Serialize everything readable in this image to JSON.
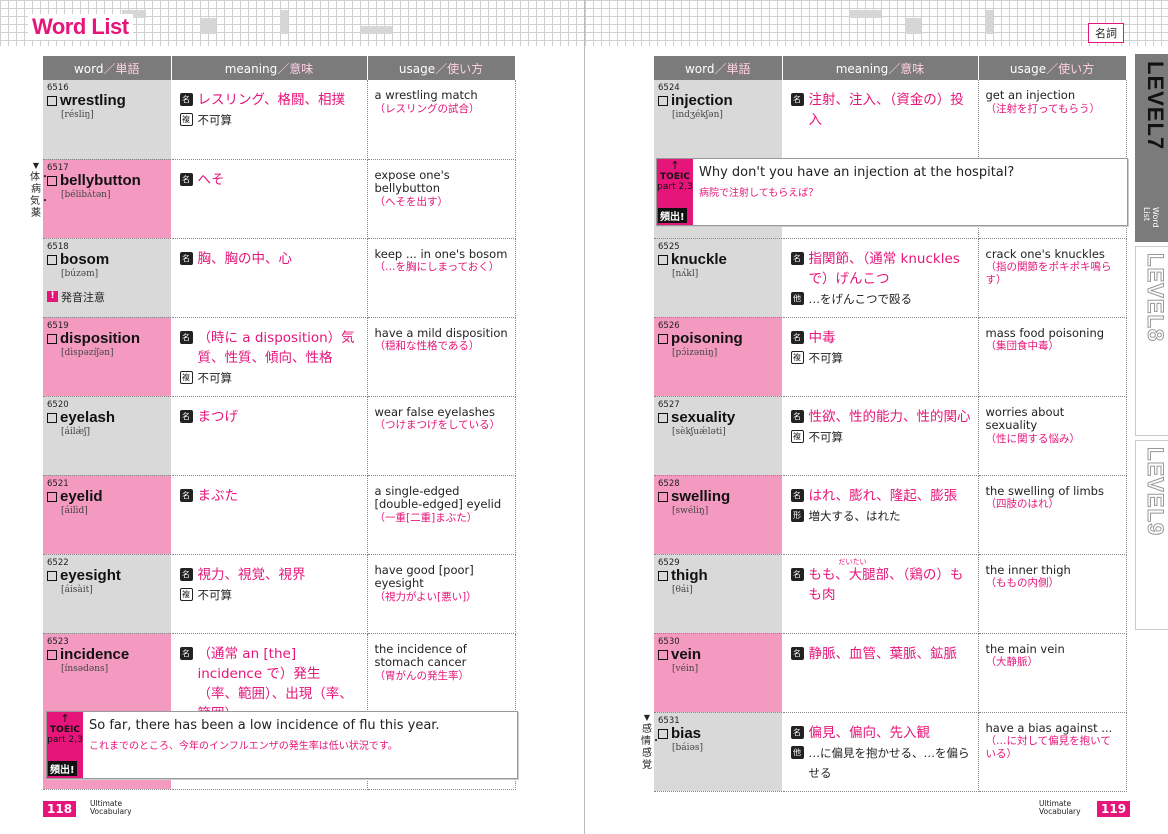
{
  "header": {
    "title": "Word List",
    "pos_tag": "名詞"
  },
  "columns": {
    "word_en": "word",
    "word_jp": "／単語",
    "meaning_en": "meaning",
    "meaning_jp": "／意味",
    "usage_en": "usage",
    "usage_jp": "／使い方"
  },
  "left_rows": [
    {
      "num": "6516",
      "word": "wrestling",
      "ipa": "[résliŋ]",
      "meanings": [
        {
          "badge": "名",
          "text": "レスリング、格闘、相撲",
          "pink": true
        },
        {
          "badge": "複",
          "text": "不可算",
          "pink": false
        }
      ],
      "usage": "a wrestling match",
      "usage_jp": "（レスリングの試合）"
    },
    {
      "num": "6517",
      "word": "bellybutton",
      "ipa": "[bélibʌ̀tən]",
      "meanings": [
        {
          "badge": "名",
          "text": "へそ",
          "pink": true
        }
      ],
      "usage": "expose one's bellybutton",
      "usage_jp": "（へそを出す）"
    },
    {
      "num": "6518",
      "word": "bosom",
      "ipa": "[búzəm]",
      "meanings": [
        {
          "badge": "名",
          "text": "胸、胸の中、心",
          "pink": true
        }
      ],
      "usage": "keep ... in one's bosom",
      "usage_jp": "（…を胸にしまっておく）",
      "pron_note": "発音注意"
    },
    {
      "num": "6519",
      "word": "disposition",
      "ipa": "[dìspəzíʃən]",
      "meanings": [
        {
          "badge": "名",
          "text": "（時に a disposition）気質、性質、傾向、性格",
          "pink": true
        },
        {
          "badge": "複",
          "text": "不可算",
          "pink": false
        }
      ],
      "usage": "have a mild disposition",
      "usage_jp": "（穏和な性格である）"
    },
    {
      "num": "6520",
      "word": "eyelash",
      "ipa": "[áilæ̀ʃ]",
      "meanings": [
        {
          "badge": "名",
          "text": "まつげ",
          "pink": true
        }
      ],
      "usage": "wear false eyelashes",
      "usage_jp": "（つけまつげをしている）"
    },
    {
      "num": "6521",
      "word": "eyelid",
      "ipa": "[áilìd]",
      "meanings": [
        {
          "badge": "名",
          "text": "まぶた",
          "pink": true
        }
      ],
      "usage": "a single-edged [double-edged] eyelid",
      "usage_jp": "（一重[二重]まぶた）"
    },
    {
      "num": "6522",
      "word": "eyesight",
      "ipa": "[áisàit]",
      "meanings": [
        {
          "badge": "名",
          "text": "視力、視覚、視界",
          "pink": true
        },
        {
          "badge": "複",
          "text": "不可算",
          "pink": false
        }
      ],
      "usage": "have good [poor] eyesight",
      "usage_jp": "（視力がよい[悪い]）"
    },
    {
      "num": "6523",
      "word": "incidence",
      "ipa": "[ínsədəns]",
      "meanings": [
        {
          "badge": "名",
          "text": "（通常 an [the] incidence で）発生（率、範囲）、出現（率、範囲）",
          "pink": true
        }
      ],
      "usage": "the incidence of stomach cancer",
      "usage_jp": "（胃がんの発生率）"
    }
  ],
  "right_rows": [
    {
      "num": "6524",
      "word": "injection",
      "ipa": "[indʒékʃən]",
      "meanings": [
        {
          "badge": "名",
          "text": "注射、注入、（資金の）投入",
          "pink": true
        }
      ],
      "usage": "get an injection",
      "usage_jp": "（注射を打ってもらう）"
    },
    {
      "num": "6525",
      "word": "knuckle",
      "ipa": "[nʌ́kl]",
      "meanings": [
        {
          "badge": "名",
          "text": "指関節、（通常 knuckles で）げんこつ",
          "pink": true
        },
        {
          "badge": "他",
          "text": "…をげんこつで殴る",
          "pink": false
        }
      ],
      "usage": "crack one's knuckles",
      "usage_jp": "（指の関節をポキポキ鳴らす）"
    },
    {
      "num": "6526",
      "word": "poisoning",
      "ipa": "[pɔ́izəniŋ]",
      "meanings": [
        {
          "badge": "名",
          "text": "中毒",
          "pink": true
        },
        {
          "badge": "複",
          "text": "不可算",
          "pink": false
        }
      ],
      "usage": "mass food poisoning",
      "usage_jp": "（集団食中毒）"
    },
    {
      "num": "6527",
      "word": "sexuality",
      "ipa": "[sèkʃuǽləti]",
      "meanings": [
        {
          "badge": "名",
          "text": "性欲、性的能力、性的関心",
          "pink": true
        },
        {
          "badge": "複",
          "text": "不可算",
          "pink": false
        }
      ],
      "usage": "worries about sexuality",
      "usage_jp": "（性に関する悩み）"
    },
    {
      "num": "6528",
      "word": "swelling",
      "ipa": "[swéliŋ]",
      "meanings": [
        {
          "badge": "名",
          "text": "はれ、膨れ、隆起、膨張",
          "pink": true
        },
        {
          "badge": "形",
          "text": "増大する、はれた",
          "pink": false
        }
      ],
      "usage": "the swelling of limbs",
      "usage_jp": "（四肢のはれ）"
    },
    {
      "num": "6529",
      "word": "thigh",
      "ipa": "[θái]",
      "meanings": [
        {
          "badge": "名",
          "text": "もも、大腿部、（鶏の）もも肉",
          "pink": true
        }
      ],
      "usage": "the inner thigh",
      "usage_jp": "（ももの内側）",
      "ruby": "だいたい"
    },
    {
      "num": "6530",
      "word": "vein",
      "ipa": "[véin]",
      "meanings": [
        {
          "badge": "名",
          "text": "静脈、血管、葉脈、鉱脈",
          "pink": true
        }
      ],
      "usage": "the main vein",
      "usage_jp": "（大静脈）"
    },
    {
      "num": "6531",
      "word": "bias",
      "ipa": "[báiəs]",
      "meanings": [
        {
          "badge": "名",
          "text": "偏見、偏向、先入観",
          "pink": true
        },
        {
          "badge": "他",
          "text": "…に偏見を抱かせる、…を偏らせる",
          "pink": false
        }
      ],
      "usage": "have a bias against ...",
      "usage_jp": "（…に対して偏見を抱いている）"
    }
  ],
  "examples": {
    "left": {
      "toeic": "TOEIC",
      "part": "part 2,3",
      "freq": "頻出!",
      "en": "So far, there has been a low incidence of flu this year.",
      "jp": "これまでのところ、今年のインフルエンザの発生率は低い状況です。"
    },
    "right": {
      "toeic": "TOEIC",
      "part": "part 2,3",
      "freq": "頻出!",
      "en": "Why don't you have an injection at the hospital?",
      "jp": "病院で注射してもらえば？"
    }
  },
  "categories": {
    "left": "体・病気・薬",
    "right": "感情・感覚"
  },
  "folio": {
    "left_page": "118",
    "right_page": "119",
    "series_line1": "Ultimate",
    "series_line2": "Vocabulary"
  },
  "level_tabs": [
    {
      "label": "LEVEL7",
      "sub": "Word List",
      "active": true
    },
    {
      "label": "LEVEL8",
      "active": false
    },
    {
      "label": "LEVEL9",
      "active": false
    }
  ],
  "colors": {
    "accent": "#e6157a",
    "pink_cell": "#f49ac1",
    "gray_cell": "#d9d9da",
    "header": "#7b7b7b"
  }
}
